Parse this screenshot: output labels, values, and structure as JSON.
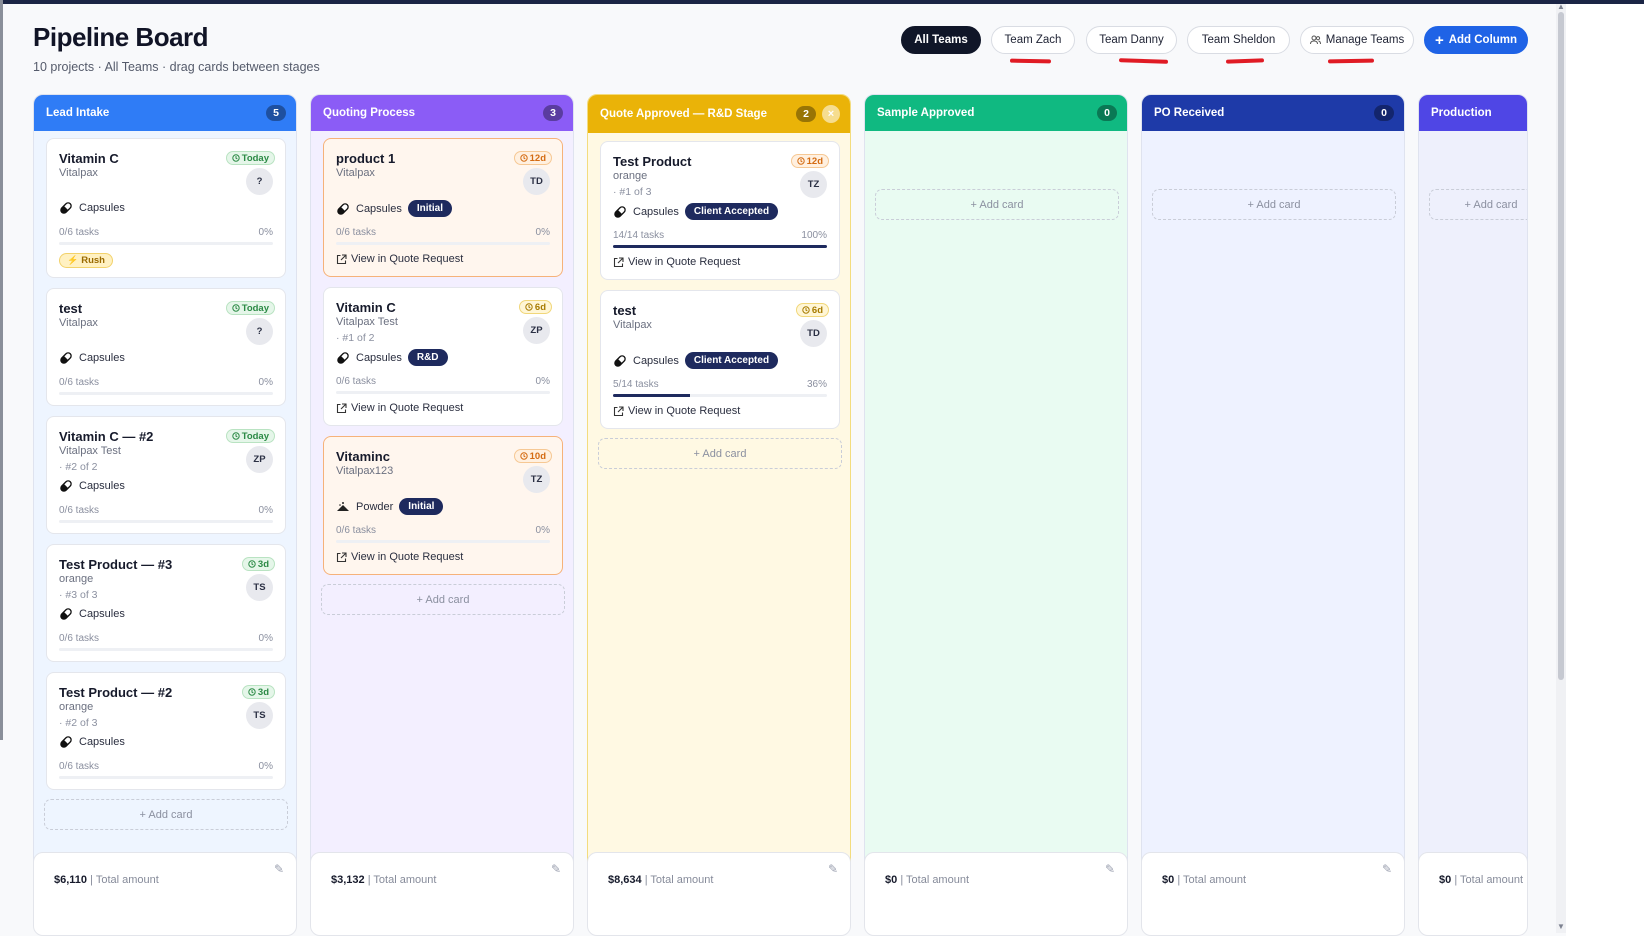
{
  "header": {
    "title": "Pipeline Board",
    "subtitle": "10 projects · All Teams · drag cards between stages"
  },
  "team_filters": {
    "all": "All Teams",
    "teams": [
      "Team Zach",
      "Team Danny",
      "Team Sheldon"
    ],
    "manage": "Manage Teams",
    "add_column": "Add Column"
  },
  "colors": {
    "lead_intake": "#2f7cf6",
    "quoting_process": "#8b5cf6",
    "quote_approved": "#eab308",
    "sample_approved": "#10b981",
    "po_received": "#1e3aa8",
    "production": "#4f46e5",
    "annotation": "#e01b24"
  },
  "columns": [
    {
      "name": "Lead Intake",
      "count": "5",
      "cards": [
        {
          "title": "Vitamin C",
          "client": "Vitalpax",
          "due": "Today",
          "avatar": "?",
          "form": "Capsules",
          "tasks": "0/6 tasks",
          "pct": "0%",
          "progress": 0,
          "rush": "Rush"
        },
        {
          "title": "test",
          "client": "Vitalpax",
          "due": "Today",
          "avatar": "?",
          "form": "Capsules",
          "tasks": "0/6 tasks",
          "pct": "0%",
          "progress": 0
        },
        {
          "title": "Vitamin C — #2",
          "client": "Vitalpax Test",
          "seq": "· #2 of 2",
          "due": "Today",
          "avatar": "ZP",
          "form": "Capsules",
          "tasks": "0/6 tasks",
          "pct": "0%",
          "progress": 0
        },
        {
          "title": "Test Product — #3",
          "client": "orange",
          "seq": "· #3 of 3",
          "due": "3d",
          "avatar": "TS",
          "form": "Capsules",
          "tasks": "0/6 tasks",
          "pct": "0%",
          "progress": 0
        },
        {
          "title": "Test Product — #2",
          "client": "orange",
          "seq": "· #2 of 3",
          "due": "3d",
          "avatar": "TS",
          "form": "Capsules",
          "tasks": "0/6 tasks",
          "pct": "0%",
          "progress": 0
        }
      ],
      "add_card": "+ Add card",
      "total": "$6,110",
      "total_label": "| Total amount"
    },
    {
      "name": "Quoting Process",
      "count": "3",
      "cards": [
        {
          "title": "product 1",
          "client": "Vitalpax",
          "due": "12d",
          "avatar": "TD",
          "form": "Capsules",
          "tag": "Initial",
          "tasks": "0/6 tasks",
          "pct": "0%",
          "progress": 0,
          "link": "View in Quote Request"
        },
        {
          "title": "Vitamin C",
          "client": "Vitalpax Test",
          "seq": "· #1 of 2",
          "due": "6d",
          "avatar": "ZP",
          "form": "Capsules",
          "tag": "R&D",
          "tasks": "0/6 tasks",
          "pct": "0%",
          "progress": 0,
          "link": "View in Quote Request"
        },
        {
          "title": "Vitaminc",
          "client": "Vitalpax123",
          "due": "10d",
          "avatar": "TZ",
          "form": "Powder",
          "tag": "Initial",
          "tasks": "0/6 tasks",
          "pct": "0%",
          "progress": 0,
          "link": "View in Quote Request"
        }
      ],
      "add_card": "+ Add card",
      "total": "$3,132",
      "total_label": "| Total amount"
    },
    {
      "name": "Quote Approved — R&D Stage",
      "count": "2",
      "cards": [
        {
          "title": "Test Product",
          "client": "orange",
          "seq": "· #1 of 3",
          "due": "12d",
          "avatar": "TZ",
          "form": "Capsules",
          "tag": "Client Accepted",
          "tasks": "14/14 tasks",
          "pct": "100%",
          "progress": 1.0,
          "link": "View in Quote Request"
        },
        {
          "title": "test",
          "client": "Vitalpax",
          "due": "6d",
          "avatar": "TD",
          "form": "Capsules",
          "tag": "Client Accepted",
          "tasks": "5/14 tasks",
          "pct": "36%",
          "progress": 0.36,
          "link": "View in Quote Request"
        }
      ],
      "add_card": "+ Add card",
      "total": "$8,634",
      "total_label": "| Total amount"
    },
    {
      "name": "Sample Approved",
      "count": "0",
      "cards": [],
      "add_card": "+ Add card",
      "total": "$0",
      "total_label": "| Total amount"
    },
    {
      "name": "PO Received",
      "count": "0",
      "cards": [],
      "add_card": "+ Add card",
      "total": "$0",
      "total_label": "| Total amount"
    },
    {
      "name": "Production",
      "count": "",
      "cards": [],
      "add_card": "+ Add card",
      "total": "$0",
      "total_label": "| Total amount"
    }
  ]
}
